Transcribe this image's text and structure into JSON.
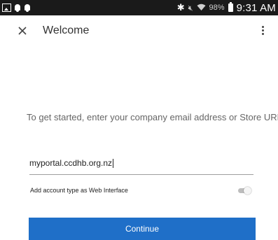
{
  "status_bar": {
    "battery": "98%",
    "time": "9:31 AM",
    "icons": [
      "gallery-icon",
      "notification-icon",
      "notification-icon",
      "bluetooth-icon",
      "mute-icon",
      "wifi-icon",
      "battery-icon"
    ]
  },
  "header": {
    "title": "Welcome",
    "close_icon": "close-icon",
    "more_icon": "more-vert-icon"
  },
  "main": {
    "instruction": "To get started, enter your company email address or Store URL",
    "url_input": {
      "value": "myportal.ccdhb.org.nz"
    },
    "web_interface": {
      "label": "Add account type as Web Interface",
      "enabled": false
    },
    "continue_label": "Continue"
  },
  "colors": {
    "accent": "#1f6fc8",
    "status_bar": "#1a1a1a"
  }
}
